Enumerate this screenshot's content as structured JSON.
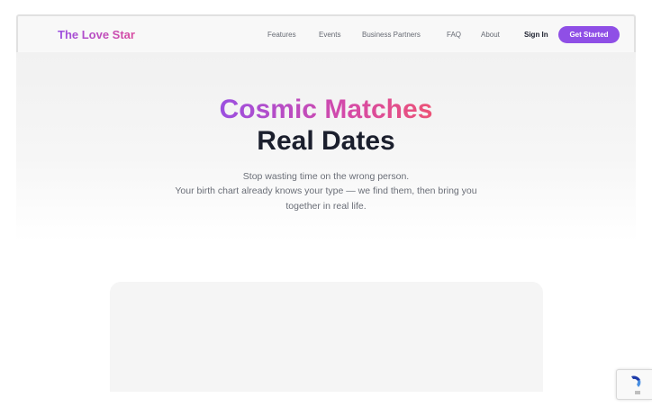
{
  "header": {
    "logo": "The Love Star",
    "nav": [
      "Features",
      "Events",
      "Business Partners",
      "FAQ",
      "About"
    ],
    "sign_in": "Sign In",
    "cta": "Get Started"
  },
  "hero": {
    "title_gradient": "Cosmic Matches",
    "title_plain": "Real Dates",
    "subtitle_lines": [
      "Stop wasting time on the wrong person.",
      "Your birth chart already knows your type — we find them, then bring you",
      "together in real life."
    ]
  },
  "colors": {
    "brand_purple": "#8f4fe6",
    "brand_pink": "#ec5276",
    "text_dark": "#1b1f2d"
  },
  "widgets": {
    "recaptcha_icon": "recaptcha-icon"
  }
}
